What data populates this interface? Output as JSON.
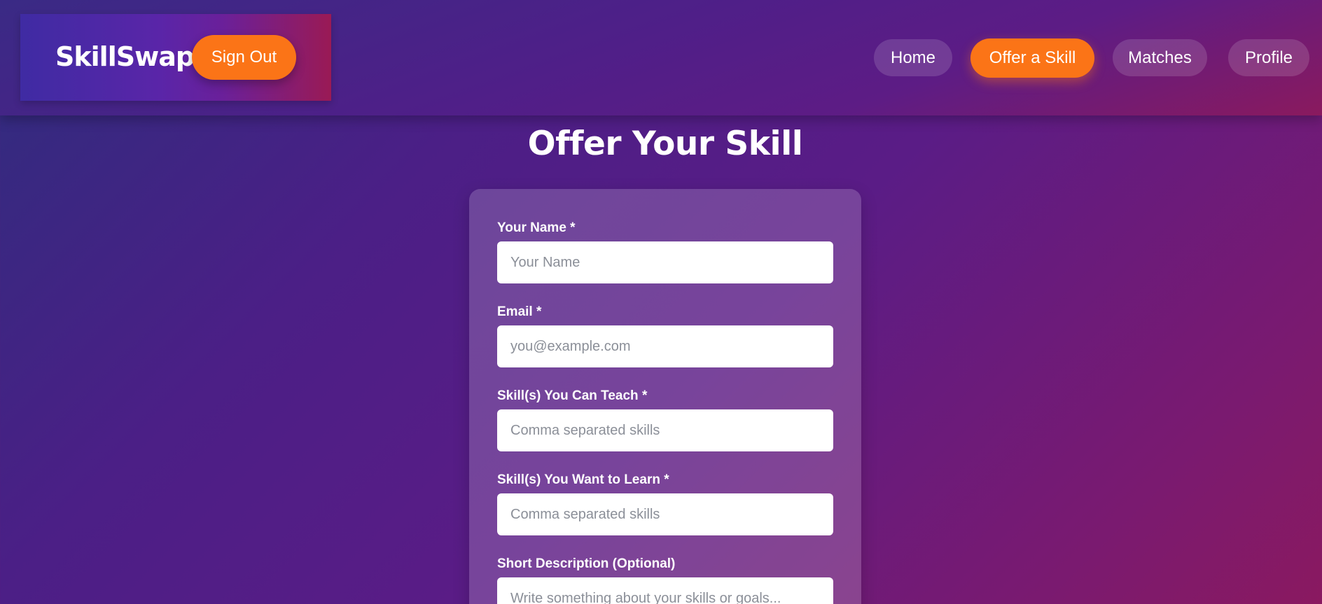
{
  "brand": {
    "name": "SkillSwap"
  },
  "header": {
    "sign_out_label": "Sign Out",
    "nav": {
      "home": "Home",
      "offer": "Offer a Skill",
      "matches": "Matches",
      "profile": "Profile"
    },
    "active_nav": "offer"
  },
  "page": {
    "title": "Offer Your Skill"
  },
  "form": {
    "name": {
      "label": "Your Name *",
      "placeholder": "Your Name",
      "value": ""
    },
    "email": {
      "label": "Email *",
      "placeholder": "you@example.com",
      "value": ""
    },
    "teach": {
      "label": "Skill(s) You Can Teach *",
      "placeholder": "Comma separated skills",
      "value": ""
    },
    "learn": {
      "label": "Skill(s) You Want to Learn *",
      "placeholder": "Comma separated skills",
      "value": ""
    },
    "description": {
      "label": "Short Description (Optional)",
      "placeholder": "Write something about your skills or goals...",
      "value": ""
    }
  },
  "colors": {
    "accent": "#fb7417",
    "background_start": "#2f2d7e",
    "background_end": "#8a1960"
  }
}
